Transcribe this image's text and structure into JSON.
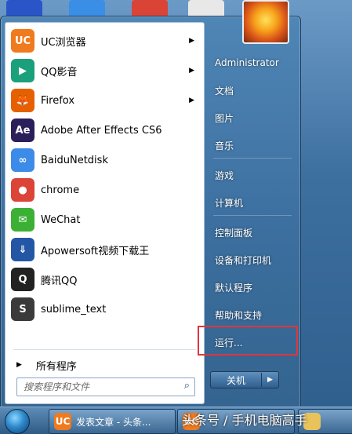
{
  "programs": [
    {
      "label": "UC浏览器",
      "icon": "uc-browser-icon",
      "color": "#f07a1e",
      "glyph": "UC",
      "has_arrow": true
    },
    {
      "label": "QQ影音",
      "icon": "qq-player-icon",
      "color": "#1aa07a",
      "glyph": "▶",
      "has_arrow": true
    },
    {
      "label": "Firefox",
      "icon": "firefox-icon",
      "color": "#e66000",
      "glyph": "🦊",
      "has_arrow": true
    },
    {
      "label": "Adobe After Effects CS6",
      "icon": "after-effects-icon",
      "color": "#2a1f5a",
      "glyph": "Ae",
      "has_arrow": false
    },
    {
      "label": "BaiduNetdisk",
      "icon": "baidu-netdisk-icon",
      "color": "#3d8be8",
      "glyph": "∞",
      "has_arrow": false
    },
    {
      "label": "chrome",
      "icon": "chrome-icon",
      "color": "#db4437",
      "glyph": "●",
      "has_arrow": false
    },
    {
      "label": "WeChat",
      "icon": "wechat-icon",
      "color": "#3cb034",
      "glyph": "✉",
      "has_arrow": false
    },
    {
      "label": "Apowersoft视频下载王",
      "icon": "apowersoft-icon",
      "color": "#2456a6",
      "glyph": "⇓",
      "has_arrow": false
    },
    {
      "label": "腾讯QQ",
      "icon": "qq-penguin-icon",
      "color": "#222222",
      "glyph": "Q",
      "has_arrow": false
    },
    {
      "label": "sublime_text",
      "icon": "sublime-text-icon",
      "color": "#3b3b3b",
      "glyph": "S",
      "has_arrow": false
    }
  ],
  "all_programs": "所有程序",
  "search": {
    "placeholder": "搜索程序和文件"
  },
  "right_pane": {
    "user": "Administrator",
    "documents": "文档",
    "pictures": "图片",
    "music": "音乐",
    "games": "游戏",
    "computer": "计算机",
    "control_panel": "控制面板",
    "devices_printers": "设备和打印机",
    "default_programs": "默认程序",
    "help_support": "帮助和支持",
    "run": "运行..."
  },
  "shutdown": {
    "label": "关机"
  },
  "taskbar": {
    "task1": "发表文章 - 头条...",
    "task2": "头条号 / 手机电脑高手"
  },
  "watermark": "头条号 / 手机电脑高手"
}
